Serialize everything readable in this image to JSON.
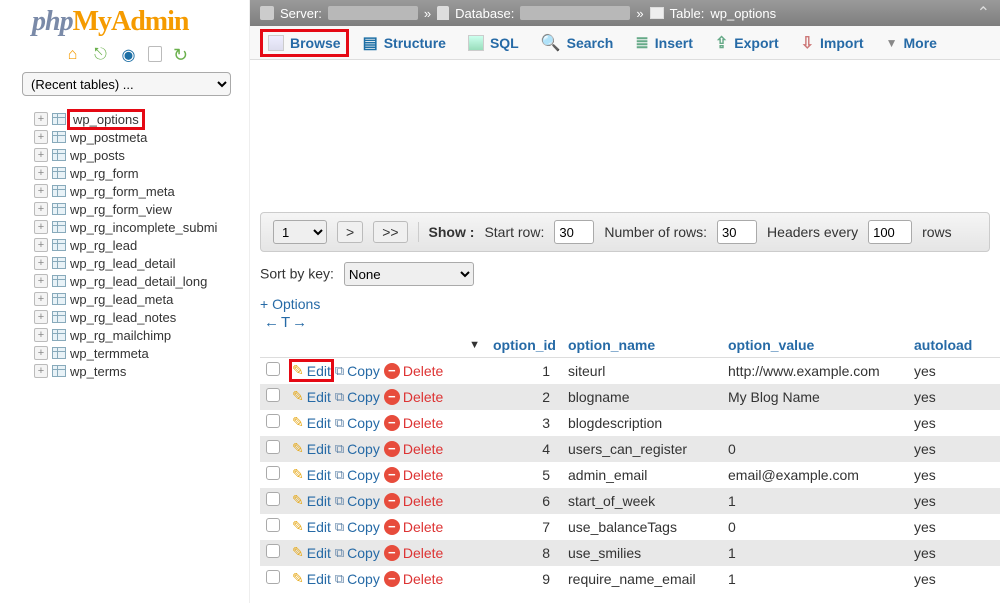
{
  "logo": {
    "p1": "php",
    "p2": "My",
    "p3": "Admin"
  },
  "recent_placeholder": "(Recent tables) ...",
  "tree": [
    {
      "name": "wp_options",
      "hl": true
    },
    {
      "name": "wp_postmeta"
    },
    {
      "name": "wp_posts"
    },
    {
      "name": "wp_rg_form"
    },
    {
      "name": "wp_rg_form_meta"
    },
    {
      "name": "wp_rg_form_view"
    },
    {
      "name": "wp_rg_incomplete_submi"
    },
    {
      "name": "wp_rg_lead"
    },
    {
      "name": "wp_rg_lead_detail"
    },
    {
      "name": "wp_rg_lead_detail_long"
    },
    {
      "name": "wp_rg_lead_meta"
    },
    {
      "name": "wp_rg_lead_notes"
    },
    {
      "name": "wp_rg_mailchimp"
    },
    {
      "name": "wp_termmeta"
    },
    {
      "name": "wp_terms"
    }
  ],
  "breadcrumb": {
    "server_label": "Server:",
    "db_label": "Database:",
    "table_label": "Table:",
    "table": "wp_options",
    "arrow": "»"
  },
  "tabs": {
    "browse": "Browse",
    "structure": "Structure",
    "sql": "SQL",
    "search": "Search",
    "insert": "Insert",
    "export": "Export",
    "import": "Import",
    "more": "More"
  },
  "nav": {
    "page": "1",
    "next": ">",
    "last": ">>",
    "show": "Show :",
    "start_label": "Start row:",
    "start": "30",
    "num_label": "Number of rows:",
    "num": "30",
    "head_label": "Headers every",
    "head": "100",
    "rows": "rows"
  },
  "sortkey": {
    "label": "Sort by key:",
    "value": "None"
  },
  "options": "+ Options",
  "arrows": "←T→",
  "headers": {
    "id": "option_id",
    "name": "option_name",
    "value": "option_value",
    "auto": "autoload"
  },
  "actions": {
    "edit": "Edit",
    "copy": "Copy",
    "delete": "Delete"
  },
  "rows": [
    {
      "id": "1",
      "name": "siteurl",
      "value": "http://www.example.com",
      "auto": "yes",
      "hl": true
    },
    {
      "id": "2",
      "name": "blogname",
      "value": "My Blog Name",
      "auto": "yes"
    },
    {
      "id": "3",
      "name": "blogdescription",
      "value": "",
      "auto": "yes"
    },
    {
      "id": "4",
      "name": "users_can_register",
      "value": "0",
      "auto": "yes"
    },
    {
      "id": "5",
      "name": "admin_email",
      "value": "email@example.com",
      "auto": "yes"
    },
    {
      "id": "6",
      "name": "start_of_week",
      "value": "1",
      "auto": "yes"
    },
    {
      "id": "7",
      "name": "use_balanceTags",
      "value": "0",
      "auto": "yes"
    },
    {
      "id": "8",
      "name": "use_smilies",
      "value": "1",
      "auto": "yes"
    },
    {
      "id": "9",
      "name": "require_name_email",
      "value": "1",
      "auto": "yes"
    }
  ]
}
